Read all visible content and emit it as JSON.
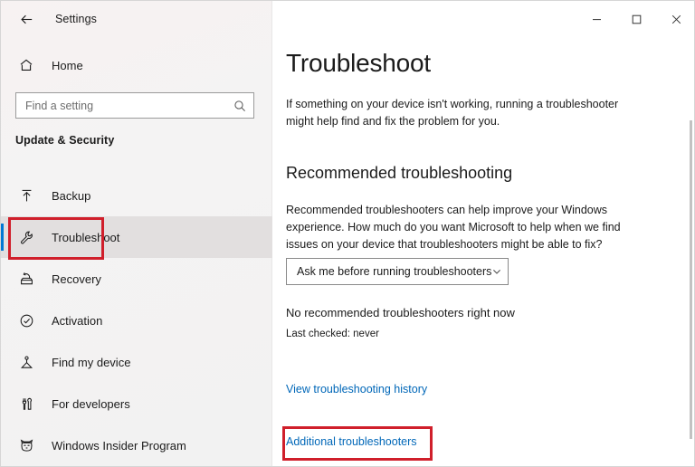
{
  "window": {
    "title": "Settings",
    "back_icon": "back-arrow-icon",
    "controls": [
      {
        "name": "minimize-button",
        "glyph": "minimize-icon",
        "label": "Minimize"
      },
      {
        "name": "maximize-button",
        "glyph": "maximize-icon",
        "label": "Maximize"
      },
      {
        "name": "close-button",
        "glyph": "close-icon",
        "label": "Close"
      }
    ]
  },
  "sidebar": {
    "home": {
      "label": "Home",
      "icon": "home-icon"
    },
    "search": {
      "value": "",
      "placeholder": "Find a setting",
      "icon": "search-icon"
    },
    "category": "Update & Security",
    "items": [
      {
        "label": "Backup",
        "icon": "backup-upload-icon",
        "selected": false
      },
      {
        "label": "Troubleshoot",
        "icon": "wrench-icon",
        "selected": true
      },
      {
        "label": "Recovery",
        "icon": "recovery-icon",
        "selected": false
      },
      {
        "label": "Activation",
        "icon": "check-circle-icon",
        "selected": false
      },
      {
        "label": "Find my device",
        "icon": "location-pin-icon",
        "selected": false
      },
      {
        "label": "For developers",
        "icon": "tools-icon",
        "selected": false
      },
      {
        "label": "Windows Insider Program",
        "icon": "ninjacat-icon",
        "selected": false
      }
    ]
  },
  "content": {
    "heading": "Troubleshoot",
    "description": "If something on your device isn't working, running a troubleshooter might help find and fix the problem for you.",
    "recommended": {
      "heading": "Recommended troubleshooting",
      "description": "Recommended troubleshooters can help improve your Windows experience. How much do you want Microsoft to help when we find issues on your device that troubleshooters might be able to fix?",
      "dropdown": {
        "selected": "Ask me before running troubleshooters",
        "chevron_icon": "chevron-down-icon"
      },
      "status": "No recommended troubleshooters right now",
      "last_checked": "Last checked: never"
    },
    "links": [
      {
        "label": "View troubleshooting history"
      },
      {
        "label": "Additional troubleshooters"
      }
    ]
  },
  "annotations": {
    "accent_red": "#d01f2b",
    "targets": [
      "Troubleshoot",
      "Additional troubleshooters"
    ]
  },
  "colors": {
    "link_blue": "#0067b8",
    "selection_blue": "#0078d4",
    "sidebar_bg": "#f4f3f3",
    "content_bg": "#ffffff",
    "text": "#1b1b1b"
  }
}
